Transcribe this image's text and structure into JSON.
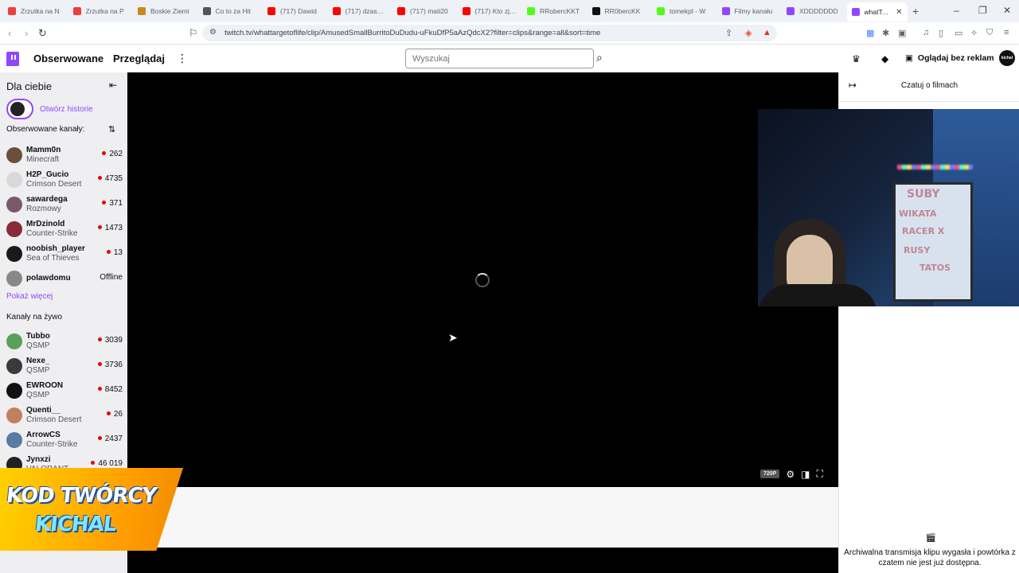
{
  "browser": {
    "tabs": [
      {
        "title": "Zrzutka na N",
        "color": "#e8403a"
      },
      {
        "title": "Zrzutka na P",
        "color": "#e8403a"
      },
      {
        "title": "Boskie Ziemi",
        "color": "#c98a1a"
      },
      {
        "title": "Co to za Hit",
        "color": "#555555"
      },
      {
        "title": "(717) Dawid",
        "color": "#ff0000"
      },
      {
        "title": "(717) dzasper",
        "color": "#ff0000"
      },
      {
        "title": "(717) mati20",
        "color": "#ff0000"
      },
      {
        "title": "(717) Kto zjed",
        "color": "#ff0000"
      },
      {
        "title": "RRobercKKT",
        "color": "#53fc18"
      },
      {
        "title": "RR0bercKK",
        "color": "#111111"
      },
      {
        "title": "tomekpl - W",
        "color": "#53fc18"
      },
      {
        "title": "Filmy kanału",
        "color": "#9147ff"
      },
      {
        "title": "XDDDDDDD",
        "color": "#9147ff"
      },
      {
        "title": "whatTarg",
        "color": "#9147ff"
      }
    ],
    "url": "twitch.tv/whattargetoflife/clip/AmusedSmallBurritoDuDudu-uFkuDfP5aAzQdcX2?filter=clips&range=all&sort=time"
  },
  "topnav": {
    "followed": "Obserwowane",
    "browse": "Przeglądaj",
    "search_placeholder": "Wyszukaj",
    "ad_free": "Oglądaj bez reklam",
    "avatar_text": "kichal"
  },
  "sidebar": {
    "title": "Dla ciebie",
    "stories": "Otwórz historie",
    "followed_header": "Obserwowane kanały:",
    "followed": [
      {
        "name": "Mamm0n",
        "game": "Minecraft",
        "viewers": "262",
        "color": "#6b4f3a"
      },
      {
        "name": "H2P_Gucio",
        "game": "Crimson Desert",
        "viewers": "4735",
        "color": "#d9d9d9"
      },
      {
        "name": "sawardega",
        "game": "Rozmowy",
        "viewers": "371",
        "color": "#7a5a6a"
      },
      {
        "name": "MrDzinold",
        "game": "Counter-Strike",
        "viewers": "1473",
        "color": "#8a2a3a"
      },
      {
        "name": "noobish_player",
        "game": "Sea of Thieves",
        "viewers": "13",
        "color": "#1a1a1a"
      },
      {
        "name": "polawdomu",
        "game": "",
        "viewers": "Offline",
        "color": "#888888"
      }
    ],
    "show_more": "Pokaż więcej",
    "live_header": "Kanały na żywo",
    "live": [
      {
        "name": "Tubbo",
        "game": "QSMP",
        "viewers": "3039",
        "color": "#5aa05a"
      },
      {
        "name": "Nexe_",
        "game": "QSMP",
        "viewers": "3736",
        "color": "#3a3a3a"
      },
      {
        "name": "EWROON",
        "game": "QSMP",
        "viewers": "8452",
        "color": "#111111"
      },
      {
        "name": "Quenti__",
        "game": "Crimson Desert",
        "viewers": "26",
        "color": "#c08060"
      },
      {
        "name": "ArrowCS",
        "game": "Counter-Strike",
        "viewers": "2437",
        "color": "#5a7aa0"
      },
      {
        "name": "Jynxzi",
        "game": "VALORANT",
        "viewers": "46 019",
        "color": "#222222"
      }
    ]
  },
  "player": {
    "quality": "720P"
  },
  "chat": {
    "title": "Czatuj o filmach",
    "message": "Archiwalna transmisja klipu wygasła i powtórka z czatem nie jest już dostępna."
  },
  "banner": {
    "line1": "KOD TWÓRCY",
    "line2": "KICHAL"
  },
  "webcam": {
    "board_text": [
      "SUBY",
      "WIKATA",
      "RACER X",
      "RUSY",
      "TATOS"
    ]
  }
}
